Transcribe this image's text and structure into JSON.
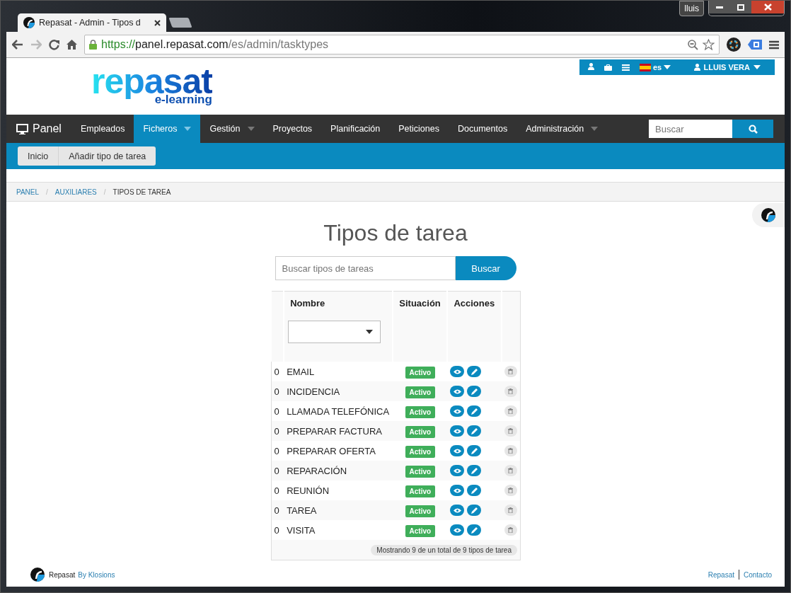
{
  "window": {
    "user_badge": "lluis"
  },
  "browser": {
    "tab_title": "Repasat - Admin - Tipos d",
    "url_scheme": "https://",
    "url_host": "panel.repasat.com",
    "url_path": "/es/admin/tasktypes"
  },
  "topbar": {
    "language": "es",
    "user": "LLUIS VERA"
  },
  "logo": {
    "name": "repasat",
    "tagline": "e-learning"
  },
  "nav": {
    "brand": "Panel",
    "items": [
      {
        "label": "Empleados",
        "selected": false,
        "dropdown": false
      },
      {
        "label": "Ficheros",
        "selected": true,
        "dropdown": true
      },
      {
        "label": "Gestión",
        "selected": false,
        "dropdown": true
      },
      {
        "label": "Proyectos",
        "selected": false,
        "dropdown": false
      },
      {
        "label": "Planificación",
        "selected": false,
        "dropdown": false
      },
      {
        "label": "Peticiones",
        "selected": false,
        "dropdown": false
      },
      {
        "label": "Documentos",
        "selected": false,
        "dropdown": false
      },
      {
        "label": "Administración",
        "selected": false,
        "dropdown": true
      }
    ],
    "search_placeholder": "Buscar"
  },
  "subnav": [
    "Inicio",
    "Añadir tipo de tarea"
  ],
  "breadcrumb": [
    {
      "label": "PANEL",
      "link": true
    },
    {
      "label": "AUXILIARES",
      "link": true
    },
    {
      "label": "TIPOS DE TAREA",
      "link": false
    }
  ],
  "breadcrumb_separator": "/",
  "page": {
    "title": "Tipos de tarea",
    "search_placeholder": "Buscar tipos de tareas",
    "search_button": "Buscar"
  },
  "table": {
    "columns": [
      "Nombre",
      "Situación",
      "Acciones"
    ],
    "rows": [
      {
        "index": "0",
        "name": "EMAIL",
        "status": "Activo"
      },
      {
        "index": "0",
        "name": "INCIDENCIA",
        "status": "Activo"
      },
      {
        "index": "0",
        "name": "LLAMADA TELEFÓNICA",
        "status": "Activo"
      },
      {
        "index": "0",
        "name": "PREPARAR FACTURA",
        "status": "Activo"
      },
      {
        "index": "0",
        "name": "PREPARAR OFERTA",
        "status": "Activo"
      },
      {
        "index": "0",
        "name": "REPARACIÓN",
        "status": "Activo"
      },
      {
        "index": "0",
        "name": "REUNIÓN",
        "status": "Activo"
      },
      {
        "index": "0",
        "name": "TAREA",
        "status": "Activo"
      },
      {
        "index": "0",
        "name": "VISITA",
        "status": "Activo"
      }
    ],
    "summary": "Mostrando 9 de un total de 9 tipos de tarea"
  },
  "footer": {
    "brand": "Repasat",
    "by": "By Klosions",
    "links": [
      "Repasat",
      "Contacto"
    ]
  }
}
